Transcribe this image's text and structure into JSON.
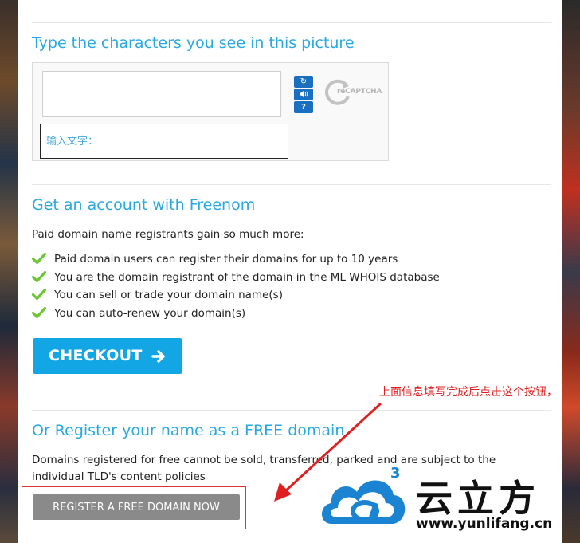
{
  "captcha": {
    "heading": "Type the characters you see in this picture",
    "input_placeholder": "输入文字：",
    "recaptcha_label": "reCAPTCHA"
  },
  "account": {
    "heading": "Get an account with Freenom",
    "intro": "Paid domain name registrants gain so much more:",
    "benefits": [
      "Paid domain users can register their domains for up to 10 years",
      "You are the domain registrant of the domain in the ML WHOIS database",
      "You can sell or trade your domain name(s)",
      "You can auto-renew your domain(s)"
    ],
    "checkout_label": "CHECKOUT"
  },
  "free": {
    "heading": "Or Register your name as a FREE domain",
    "description": "Domains registered for free cannot be sold, transferred, parked and are subject to the individual TLD's content policies",
    "register_label": "REGISTER A FREE DOMAIN NOW"
  },
  "annotation": {
    "text": "上面信息填写完成后点击这个按钮，"
  },
  "watermark": {
    "name_cn": "云立方",
    "url": "www.yunlifang.cn",
    "superscript": "3"
  },
  "colors": {
    "accent": "#29a9e1",
    "checkout_bg": "#12a6e4",
    "check_green": "#6ac632",
    "annotation_red": "#e02020",
    "register_bg": "#8a8a8a"
  }
}
